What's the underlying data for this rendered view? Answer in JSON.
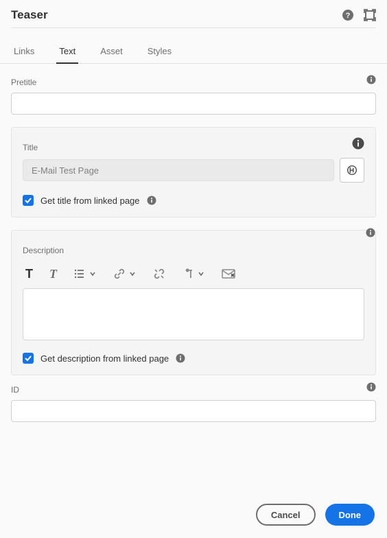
{
  "header": {
    "title": "Teaser"
  },
  "tabs": {
    "items": [
      {
        "label": "Links"
      },
      {
        "label": "Text"
      },
      {
        "label": "Asset"
      },
      {
        "label": "Styles"
      }
    ],
    "activeIndex": 1
  },
  "fields": {
    "pretitle": {
      "label": "Pretitle",
      "value": ""
    },
    "title": {
      "label": "Title",
      "value": "E-Mail Test Page",
      "checkboxLabel": "Get title from linked page",
      "checked": true
    },
    "description": {
      "label": "Description",
      "checkboxLabel": "Get description from linked page",
      "checked": true
    },
    "id": {
      "label": "ID",
      "value": ""
    }
  },
  "footer": {
    "cancel": "Cancel",
    "done": "Done"
  }
}
